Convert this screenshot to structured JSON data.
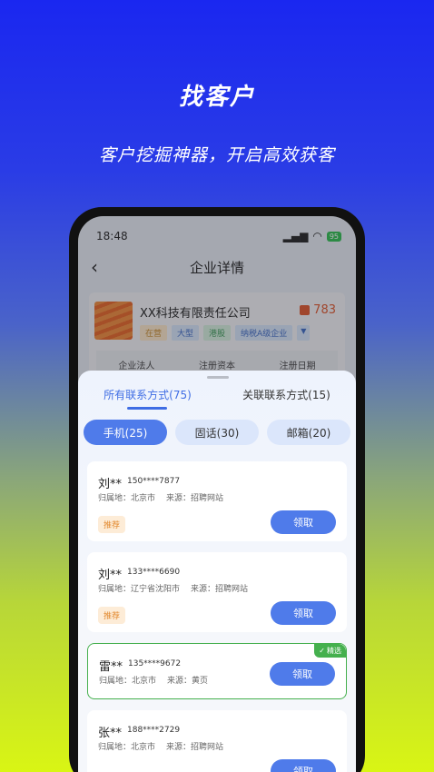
{
  "hero": {
    "title": "找客户",
    "subtitle": "客户挖掘神器，开启高效获客"
  },
  "status_bar": {
    "time": "18:48",
    "battery": "95"
  },
  "header": {
    "title": "企业详情"
  },
  "company": {
    "name": "XX科技有限责任公司",
    "score": "783",
    "tags": [
      "在营",
      "大型",
      "港股",
      "纳税A级企业"
    ],
    "info_columns": [
      "企业法人",
      "注册资本",
      "注册日期"
    ]
  },
  "tabs": [
    {
      "label": "所有联系方式(75)",
      "active": true
    },
    {
      "label": "关联联系方式(15)",
      "active": false
    }
  ],
  "filters": [
    {
      "label": "手机(25)",
      "active": true
    },
    {
      "label": "固话(30)",
      "active": false
    },
    {
      "label": "邮箱(20)",
      "active": false
    }
  ],
  "contacts": [
    {
      "name": "刘**",
      "phone": "150****7877",
      "location_label": "归属地：",
      "location": "北京市",
      "source_label": "来源：",
      "source": "招聘网站",
      "tag": "推荐",
      "button": "领取",
      "featured": false
    },
    {
      "name": "刘**",
      "phone": "133****6690",
      "location_label": "归属地：",
      "location": "辽宁省沈阳市",
      "source_label": "来源：",
      "source": "招聘网站",
      "tag": "推荐",
      "button": "领取",
      "featured": false
    },
    {
      "name": "雷**",
      "phone": "135****9672",
      "location_label": "归属地：",
      "location": "北京市",
      "source_label": "来源：",
      "source": "黄页",
      "tag": "",
      "button": "领取",
      "featured": true,
      "badge": "精选"
    },
    {
      "name": "张**",
      "phone": "188****2729",
      "location_label": "归属地：",
      "location": "北京市",
      "source_label": "来源：",
      "source": "招聘网站",
      "tag": "",
      "button": "领取",
      "featured": false
    }
  ],
  "colors": {
    "accent": "#4f7bea",
    "featured": "#45b04e",
    "recommend": "#e2882d"
  }
}
